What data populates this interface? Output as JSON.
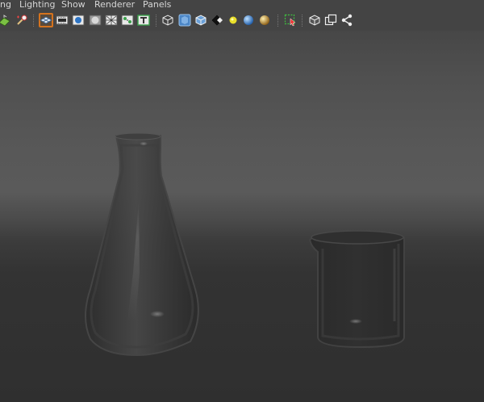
{
  "menubar": {
    "items": [
      {
        "label": "ng"
      },
      {
        "label": "Lighting"
      },
      {
        "label": "Show"
      },
      {
        "label": "Renderer"
      },
      {
        "label": "Panels"
      }
    ]
  },
  "toolbar": {
    "icons": [
      "select-camera-icon",
      "camera-attributes-icon",
      "grid-icon",
      "film-gate-icon",
      "resolution-gate-icon",
      "gate-mask-icon",
      "field-chart-icon",
      "safe-action-icon",
      "safe-title-icon",
      "wireframe-icon",
      "smooth-shade-icon",
      "wireframe-on-shaded-icon",
      "textured-icon",
      "use-all-lights-icon",
      "shadows-icon",
      "screen-space-ambient-occlusion-icon",
      "isolate-select-icon",
      "xray-icon",
      "xray-active-components-icon",
      "xray-joints-icon"
    ],
    "active_icon": "grid-icon"
  },
  "colors": {
    "panel_bg": "#444444",
    "menu_text": "#d6d6d6",
    "active_highlight": "#d5731e",
    "viewport_top": "#474747",
    "viewport_bottom": "#2f2f2f"
  },
  "viewport": {
    "objects": [
      "erlenmeyer-flask",
      "beaker"
    ]
  }
}
